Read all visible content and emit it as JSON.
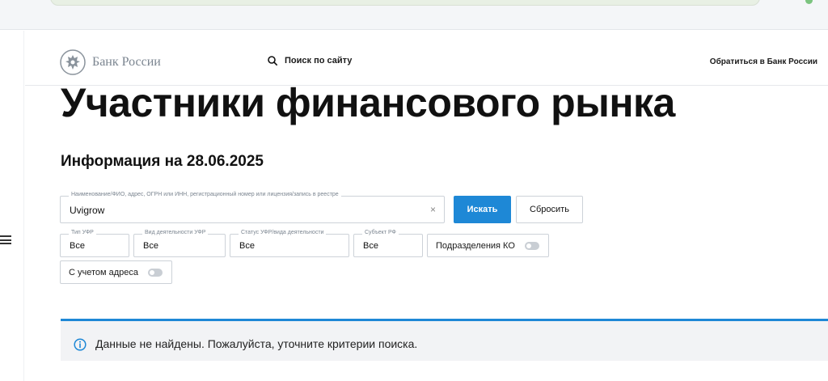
{
  "header": {
    "logo_text": "Банк России",
    "search_label": "Поиск по сайту",
    "contact_label": "Обратиться в Банк России"
  },
  "page": {
    "title": "Участники финансового рынка",
    "info_date": "Информация на 28.06.2025"
  },
  "search": {
    "field_label": "Наименование/ФИО, адрес, ОГРН или ИНН, регистрационный номер или лицензия/запись в реестре",
    "value": "Uvigrow",
    "clear_icon": "×",
    "search_button": "Искать",
    "reset_button": "Сбросить"
  },
  "filters": [
    {
      "label": "Тип УФР",
      "value": "Все"
    },
    {
      "label": "Вид деятельности УФР",
      "value": "Все"
    },
    {
      "label": "Статус УФР/вида деятельности",
      "value": "Все"
    },
    {
      "label": "Субъект РФ",
      "value": "Все"
    }
  ],
  "toggles": {
    "branches": {
      "label": "Подразделения КО",
      "state": "off"
    },
    "address": {
      "label": "С учетом адреса",
      "state": "off"
    }
  },
  "notice": {
    "icon": "info-icon",
    "text": "Данные не найдены. Пожалуйста, уточните критерии поиска."
  },
  "colors": {
    "accent": "#1e88d6",
    "border": "#cdd2d8",
    "notice_bg": "#f2f3f5"
  }
}
